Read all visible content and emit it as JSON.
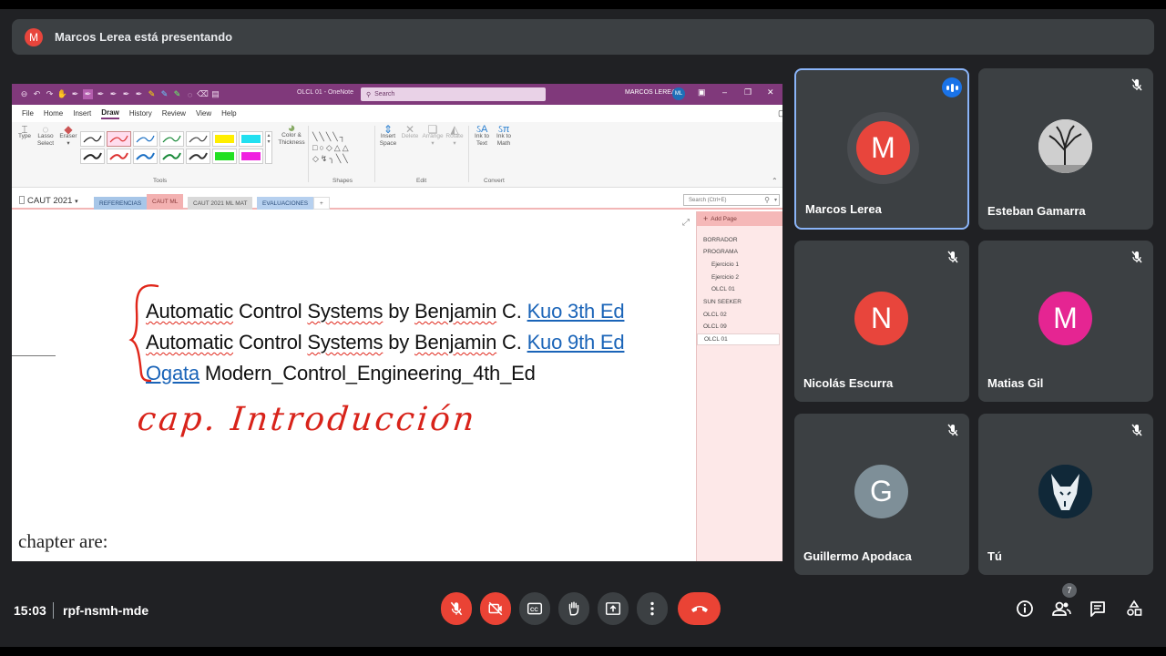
{
  "banner": {
    "avatar_letter": "M",
    "text": "Marcos Lerea está presentando",
    "avatar_color": "#e8453c"
  },
  "onenote": {
    "window_title": "OLCL 01  -  OneNote",
    "search_placeholder": "Search",
    "user_name": "MARCOS LEREA",
    "user_initials": "ML",
    "menu": [
      "File",
      "Home",
      "Insert",
      "Draw",
      "History",
      "Review",
      "View",
      "Help"
    ],
    "active_menu": "Draw",
    "ribbon": {
      "type": "Type",
      "lasso_1": "Lasso",
      "lasso_2": "Select",
      "eraser": "Eraser",
      "color_1": "Color &",
      "color_2": "Thickness",
      "insert_1": "Insert",
      "insert_2": "Space",
      "delete": "Delete",
      "arrange": "Arrange",
      "rotate": "Rotate",
      "ink_text_1": "Ink to",
      "ink_text_2": "Text",
      "ink_math_1": "Ink to",
      "ink_math_2": "Math",
      "group_tools": "Tools",
      "group_shapes": "Shapes",
      "group_edit": "Edit",
      "group_convert": "Convert"
    },
    "notebook": "CAUT 2021",
    "sections": [
      "REFERENCIAS",
      "CAUT ML",
      "CAUT 2021 ML MAT",
      "EVALUACIONES",
      "+"
    ],
    "search_notebook": "Search (Ctrl+E)",
    "add_page": "Add Page",
    "pages": [
      {
        "label": "BORRADOR",
        "level": 0
      },
      {
        "label": "PROGRAMA",
        "level": 0
      },
      {
        "label": "Ejercicio 1",
        "level": 1
      },
      {
        "label": "Ejercicio 2",
        "level": 1
      },
      {
        "label": "OLCL 01",
        "level": 1
      },
      {
        "label": "SUN SEEKER",
        "level": 0
      },
      {
        "label": "OLCL 02",
        "level": 0
      },
      {
        "label": "OLCL 09",
        "level": 0
      },
      {
        "label": "OLCL 01",
        "level": 0,
        "selected": true
      }
    ],
    "note": {
      "line1_a": "Automatic",
      "line1_b": " Control ",
      "line1_c": "Systems",
      "line1_d": " by ",
      "line1_e": "Benjamin",
      "line1_f": " C. ",
      "line1_link": "Kuo 3th Ed",
      "line2_a": "Automatic",
      "line2_b": " Control ",
      "line2_c": "Systems",
      "line2_d": " by ",
      "line2_e": "Benjamin",
      "line2_f": " C. ",
      "line2_link": "Kuo 9th Ed",
      "line3_link": "Ogata",
      "line3_rest": " Modern_Control_Engineering_4th_Ed",
      "handwritten": "cap.  Introducción",
      "chapter_text": "chapter are:"
    }
  },
  "participants": [
    {
      "name": "Marcos Lerea",
      "letter": "M",
      "color": "#e8453c",
      "speaking": true
    },
    {
      "name": "Esteban Gamarra",
      "photo": "tree",
      "muted": true
    },
    {
      "name": "Nicolás Escurra",
      "letter": "N",
      "color": "#e8453c",
      "muted": true
    },
    {
      "name": "Matias Gil",
      "letter": "M",
      "color": "#e52592",
      "muted": true
    },
    {
      "name": "Guillermo Apodaca",
      "letter": "G",
      "color": "#7e8f98",
      "muted": true
    },
    {
      "name": "Tú",
      "photo": "wolf",
      "muted": true
    }
  ],
  "bottom": {
    "time": "15:03",
    "meeting_code": "rpf-nsmh-mde",
    "people_count": "7",
    "icons": [
      "mic-off-icon",
      "camera-off-icon",
      "captions-icon",
      "raise-hand-icon",
      "present-icon",
      "more-icon",
      "end-call-icon",
      "info-icon",
      "people-icon",
      "chat-icon",
      "activities-icon"
    ]
  }
}
